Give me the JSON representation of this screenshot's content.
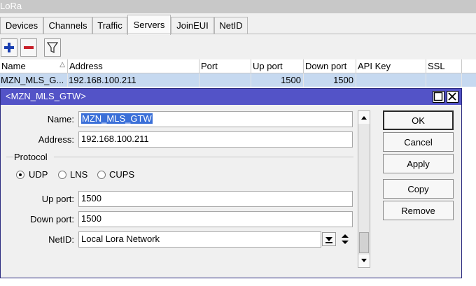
{
  "window": {
    "title": "LoRa"
  },
  "tabs": [
    {
      "label": "Devices"
    },
    {
      "label": "Channels"
    },
    {
      "label": "Traffic"
    },
    {
      "label": "Servers",
      "active": true
    },
    {
      "label": "JoinEUI"
    },
    {
      "label": "NetID"
    }
  ],
  "toolbar": {
    "icons": [
      "plus-icon",
      "minus-icon",
      "filter-icon"
    ]
  },
  "table": {
    "columns": [
      "Name",
      "Address",
      "Port",
      "Up port",
      "Down port",
      "API Key",
      "SSL"
    ],
    "sort_indicator": "△",
    "rows": [
      {
        "name": "MZN_MLS_G...",
        "address": "192.168.100.211",
        "port": "",
        "up_port": "1500",
        "down_port": "1500",
        "api_key": "",
        "ssl": ""
      }
    ]
  },
  "dialog": {
    "title": "<MZN_MLS_GTW>",
    "fields": {
      "name_label": "Name:",
      "name_value": "MZN_MLS_GTW",
      "address_label": "Address:",
      "address_value": "192.168.100.211",
      "up_port_label": "Up port:",
      "up_port_value": "1500",
      "down_port_label": "Down port:",
      "down_port_value": "1500",
      "netid_label": "NetID:",
      "netid_value": "Local Lora Network"
    },
    "protocol": {
      "label": "Protocol",
      "options": [
        "UDP",
        "LNS",
        "CUPS"
      ],
      "selected": "UDP"
    },
    "buttons": {
      "ok": "OK",
      "cancel": "Cancel",
      "apply": "Apply",
      "copy": "Copy",
      "remove": "Remove"
    }
  },
  "colors": {
    "dialog_title_bg": "#5353c7",
    "row_selected_bg": "#c6d9f0",
    "add_icon": "#1a3fb0",
    "remove_icon": "#c8202a"
  }
}
